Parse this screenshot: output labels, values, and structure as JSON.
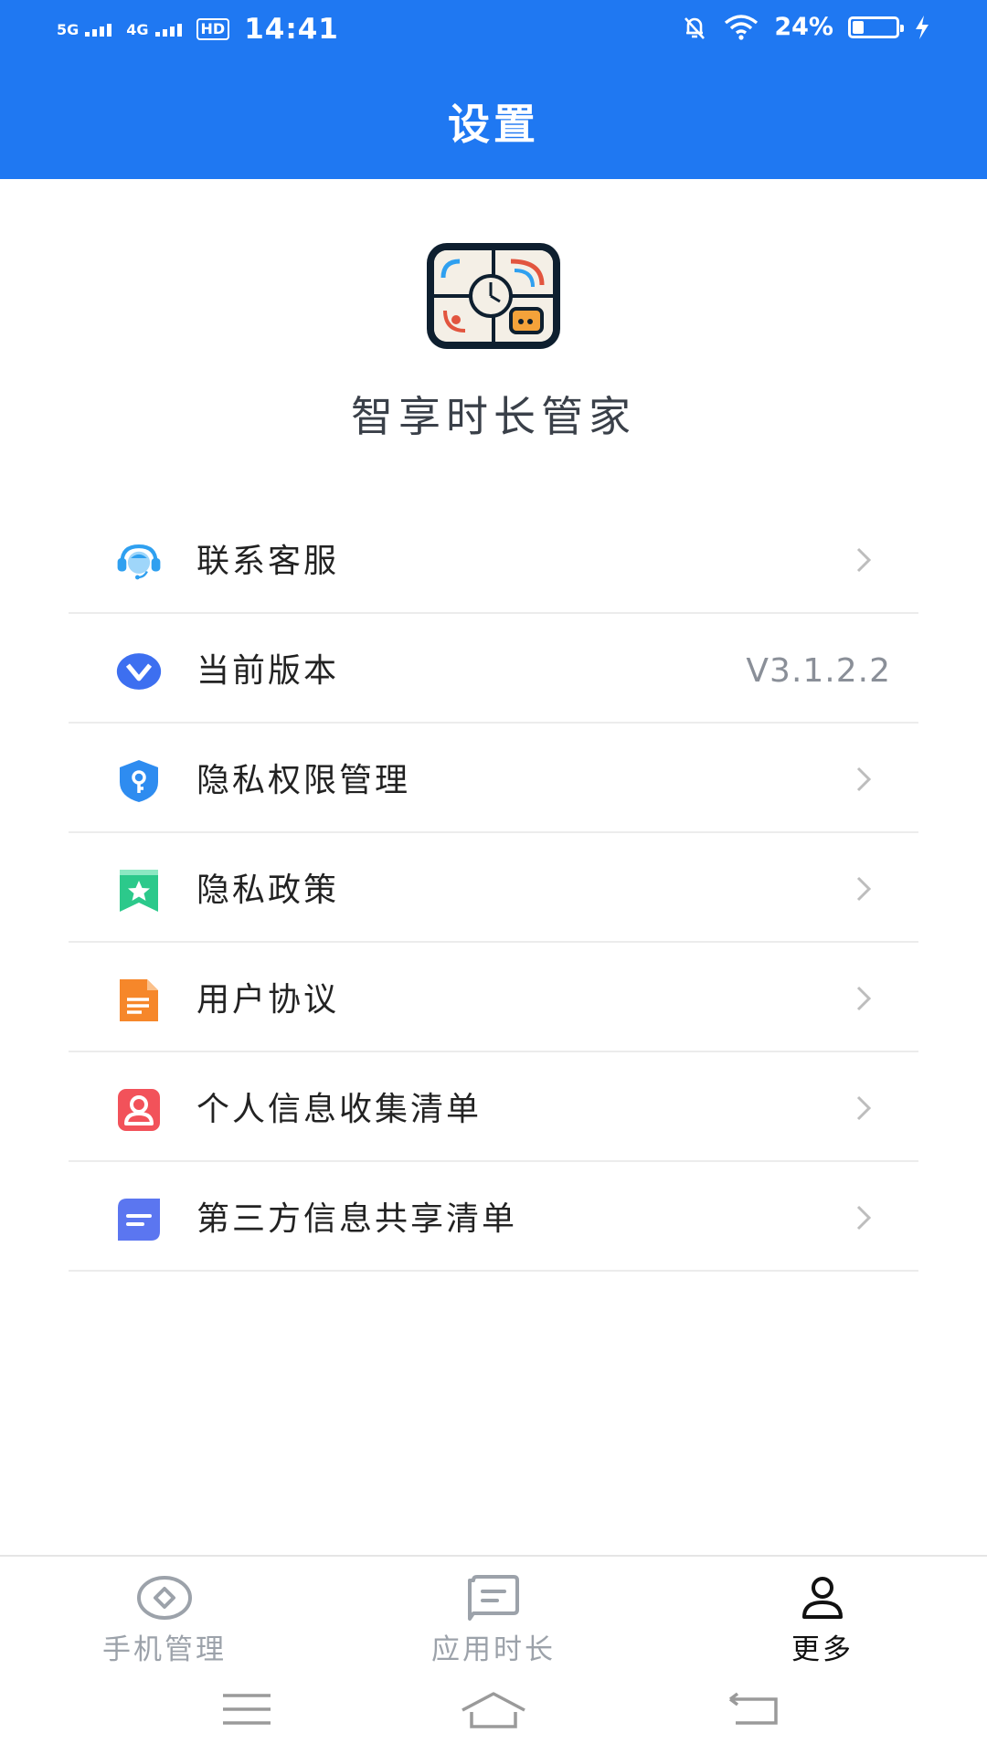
{
  "status_bar": {
    "net1": "5G",
    "net2": "4G",
    "hd": "HD",
    "time": "14:41",
    "battery_percent_label": "24%",
    "battery_level": 0.24,
    "icons": [
      "mute-bell-icon",
      "wifi-icon",
      "battery-icon",
      "charging-bolt-icon"
    ]
  },
  "header": {
    "title": "设置"
  },
  "app": {
    "name": "智享时长管家",
    "logo_icon": "app-logo-icon"
  },
  "menu": {
    "items": [
      {
        "label": "联系客服",
        "icon": "customer-service-icon",
        "color": "#2FA0F0"
      },
      {
        "label": "当前版本",
        "icon": "version-v-icon",
        "color": "#3D6FF0",
        "value": "V3.1.2.2"
      },
      {
        "label": "隐私权限管理",
        "icon": "shield-key-icon",
        "color": "#2E8CF0"
      },
      {
        "label": "隐私政策",
        "icon": "bookmark-star-icon",
        "color": "#2CC98B"
      },
      {
        "label": "用户协议",
        "icon": "document-icon",
        "color": "#F6872A"
      },
      {
        "label": "个人信息收集清单",
        "icon": "user-card-icon",
        "color": "#F2525A"
      },
      {
        "label": "第三方信息共享清单",
        "icon": "list-card-icon",
        "color": "#5B76F0"
      }
    ]
  },
  "tabbar": {
    "tabs": [
      {
        "label": "手机管理",
        "icon": "phone-manage-icon",
        "active": false
      },
      {
        "label": "应用时长",
        "icon": "app-duration-icon",
        "active": false
      },
      {
        "label": "更多",
        "icon": "more-user-icon",
        "active": true
      }
    ]
  },
  "colors": {
    "primary": "#1F78F2",
    "inactive": "#9CA2AA",
    "active": "#111111"
  }
}
